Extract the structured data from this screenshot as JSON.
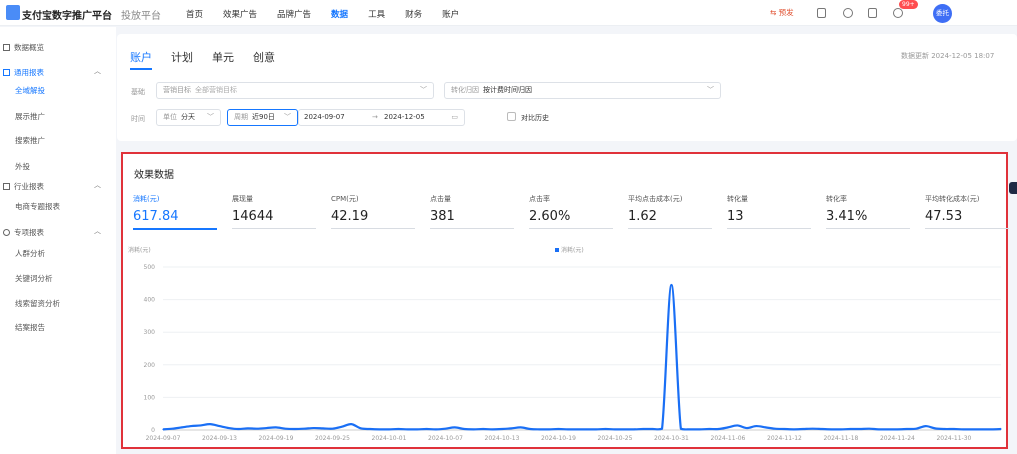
{
  "header": {
    "logo_title": "支付宝数字推广平台",
    "logo_subtitle": "投放平台",
    "nav": [
      "首页",
      "效果广告",
      "品牌广告",
      "数据",
      "工具",
      "财务",
      "账户"
    ],
    "nav_active_index": 3,
    "preview_label": "⇆ 预发",
    "notification_count": "99+",
    "avatar_text": "委托"
  },
  "sidebar": {
    "overview": "数据概览",
    "general_group": "通用报表",
    "general_items": [
      "全域解投",
      "展示推广",
      "搜索推广",
      "外投"
    ],
    "general_active_index": 0,
    "industry_group": "行业报表",
    "industry_items": [
      "电商专题报表"
    ],
    "special_group": "专项报表",
    "special_items": [
      "人群分析",
      "关键词分析",
      "线索留资分析",
      "结案报告"
    ]
  },
  "filters": {
    "tabs": [
      "账户",
      "计划",
      "单元",
      "创意"
    ],
    "active_tab": 0,
    "update_time": "数据更新 2024-12-05 18:07",
    "basic_label": "基础",
    "goal_key": "营销目标",
    "goal_value": "全部营销目标",
    "attribution_key": "转化归因",
    "attribution_value": "按计费时间归因",
    "time_label": "时间",
    "unit_key": "单位",
    "unit_value": "分天",
    "period_key": "周期",
    "period_value": "近90日",
    "date_start": "2024-09-07",
    "date_sep": "→",
    "date_end": "2024-12-05",
    "compare_label": "对比历史"
  },
  "effect": {
    "title": "效果数据",
    "metrics": [
      {
        "label": "消耗(元)",
        "value": "617.84"
      },
      {
        "label": "展现量",
        "value": "14644"
      },
      {
        "label": "CPM(元)",
        "value": "42.19"
      },
      {
        "label": "点击量",
        "value": "381"
      },
      {
        "label": "点击率",
        "value": "2.60%"
      },
      {
        "label": "平均点击成本(元)",
        "value": "1.62"
      },
      {
        "label": "转化量",
        "value": "13"
      },
      {
        "label": "转化率",
        "value": "3.41%"
      },
      {
        "label": "平均转化成本(元)",
        "value": "47.53"
      }
    ],
    "active_metric": 0
  },
  "chart_data": {
    "type": "line",
    "ylabel": "消耗(元)",
    "legend": "消耗(元)",
    "legend_position": "top-center",
    "ylim": [
      0,
      500
    ],
    "yticks": [
      0,
      100,
      200,
      300,
      400,
      500
    ],
    "grid": true,
    "color": "#1a6ff5",
    "xtick_labels": [
      "2024-09-07",
      "2024-09-13",
      "2024-09-19",
      "2024-09-25",
      "2024-10-01",
      "2024-10-07",
      "2024-10-13",
      "2024-10-19",
      "2024-10-25",
      "2024-10-31",
      "2024-11-06",
      "2024-11-12",
      "2024-11-18",
      "2024-11-24",
      "2024-11-30"
    ],
    "x": [
      "2024-09-07",
      "2024-09-08",
      "2024-09-09",
      "2024-09-10",
      "2024-09-11",
      "2024-09-12",
      "2024-09-13",
      "2024-09-14",
      "2024-09-15",
      "2024-09-16",
      "2024-09-17",
      "2024-09-18",
      "2024-09-19",
      "2024-09-20",
      "2024-09-21",
      "2024-09-22",
      "2024-09-23",
      "2024-09-24",
      "2024-09-25",
      "2024-09-26",
      "2024-09-27",
      "2024-09-28",
      "2024-09-29",
      "2024-09-30",
      "2024-10-01",
      "2024-10-02",
      "2024-10-03",
      "2024-10-04",
      "2024-10-05",
      "2024-10-06",
      "2024-10-07",
      "2024-10-08",
      "2024-10-09",
      "2024-10-10",
      "2024-10-11",
      "2024-10-12",
      "2024-10-13",
      "2024-10-14",
      "2024-10-15",
      "2024-10-16",
      "2024-10-17",
      "2024-10-18",
      "2024-10-19",
      "2024-10-20",
      "2024-10-21",
      "2024-10-22",
      "2024-10-23",
      "2024-10-24",
      "2024-10-25",
      "2024-10-26",
      "2024-10-27",
      "2024-10-28",
      "2024-10-29",
      "2024-10-30",
      "2024-10-31",
      "2024-11-01",
      "2024-11-02",
      "2024-11-03",
      "2024-11-04",
      "2024-11-05",
      "2024-11-06",
      "2024-11-07",
      "2024-11-08",
      "2024-11-09",
      "2024-11-10",
      "2024-11-11",
      "2024-11-12",
      "2024-11-13",
      "2024-11-14",
      "2024-11-15",
      "2024-11-16",
      "2024-11-17",
      "2024-11-18",
      "2024-11-19",
      "2024-11-20",
      "2024-11-21",
      "2024-11-22",
      "2024-11-23",
      "2024-11-24",
      "2024-11-25",
      "2024-11-26",
      "2024-11-27",
      "2024-11-28",
      "2024-11-29",
      "2024-11-30",
      "2024-12-01",
      "2024-12-02",
      "2024-12-03",
      "2024-12-04",
      "2024-12-05"
    ],
    "values": [
      2,
      4,
      8,
      12,
      14,
      18,
      12,
      6,
      3,
      5,
      4,
      6,
      8,
      4,
      3,
      4,
      6,
      5,
      4,
      10,
      18,
      5,
      3,
      2,
      2,
      3,
      2,
      2,
      3,
      2,
      4,
      8,
      3,
      2,
      3,
      2,
      3,
      5,
      8,
      3,
      2,
      2,
      3,
      2,
      2,
      2,
      2,
      3,
      2,
      2,
      2,
      3,
      3,
      4,
      445,
      4,
      2,
      2,
      3,
      3,
      8,
      14,
      6,
      12,
      8,
      4,
      3,
      2,
      3,
      4,
      3,
      2,
      2,
      3,
      3,
      4,
      2,
      2,
      2,
      3,
      4,
      12,
      5,
      3,
      3,
      2,
      2,
      2,
      2,
      3
    ]
  }
}
